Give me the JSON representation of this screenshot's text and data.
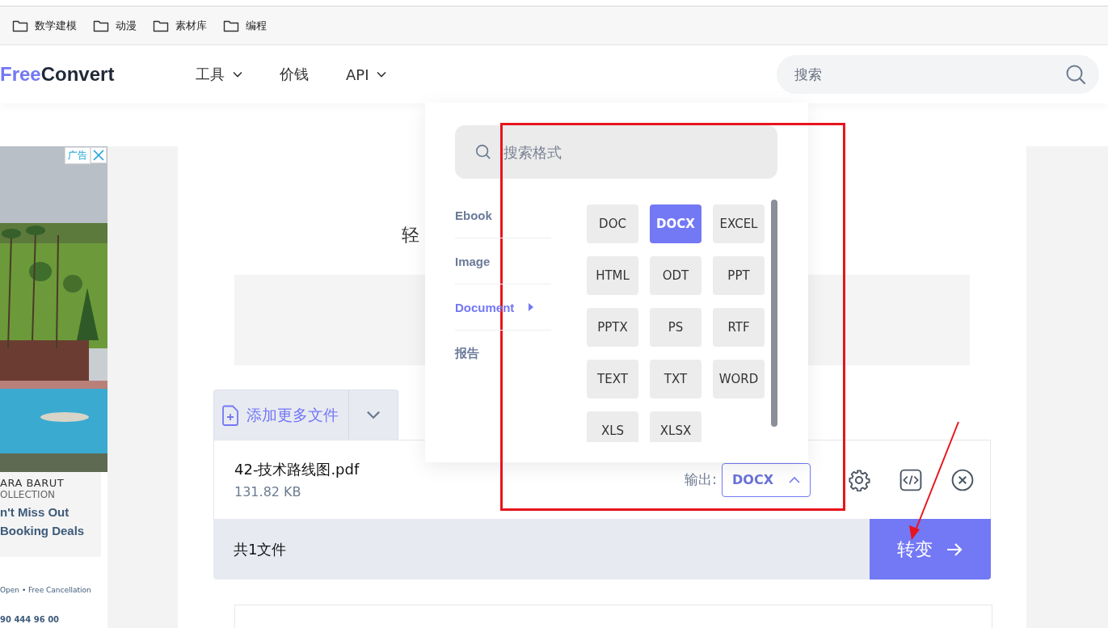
{
  "bookmarks": [
    {
      "label": "数学建模"
    },
    {
      "label": "动漫"
    },
    {
      "label": "素材库"
    },
    {
      "label": "编程"
    }
  ],
  "header": {
    "logo": {
      "part_1": "Free",
      "part_2": "Convert"
    },
    "nav": [
      {
        "label": "工具",
        "dropdown": true
      },
      {
        "label": "价钱",
        "dropdown": false
      },
      {
        "label": "API",
        "dropdown": true
      }
    ],
    "search": {
      "placeholder": "搜索"
    }
  },
  "ad": {
    "badge": "广告",
    "brand_1": "ARA BARUT",
    "brand_2": "OLLECTION",
    "headline_1": "n't Miss Out",
    "headline_2": "Booking Deals",
    "features": "Open • Free Cancellation",
    "phone": "90 444 96 00"
  },
  "main": {
    "title": "轻",
    "add_files": "添加更多文件",
    "file": {
      "name": "42-技术路线图.pdf",
      "size": "131.82 KB",
      "output_label": "输出:",
      "output_format": "DOCX",
      "dropdown_open": true
    },
    "footer": {
      "count": "共1文件",
      "convert_button": "转变"
    }
  },
  "format_menu": {
    "search_placeholder": "搜索格式",
    "categories": [
      {
        "label": "Ebook",
        "selected": false
      },
      {
        "label": "Image",
        "selected": false
      },
      {
        "label": "Document",
        "selected": true
      },
      {
        "label": "报告",
        "selected": false
      }
    ],
    "formats": [
      {
        "label": "DOC",
        "selected": false
      },
      {
        "label": "DOCX",
        "selected": true
      },
      {
        "label": "EXCEL",
        "selected": false
      },
      {
        "label": "HTML",
        "selected": false
      },
      {
        "label": "ODT",
        "selected": false
      },
      {
        "label": "PPT",
        "selected": false
      },
      {
        "label": "PPTX",
        "selected": false
      },
      {
        "label": "PS",
        "selected": false
      },
      {
        "label": "RTF",
        "selected": false
      },
      {
        "label": "TEXT",
        "selected": false
      },
      {
        "label": "TXT",
        "selected": false
      },
      {
        "label": "WORD",
        "selected": false
      },
      {
        "label": "XLS",
        "selected": false
      },
      {
        "label": "XLSX",
        "selected": false
      }
    ]
  }
}
